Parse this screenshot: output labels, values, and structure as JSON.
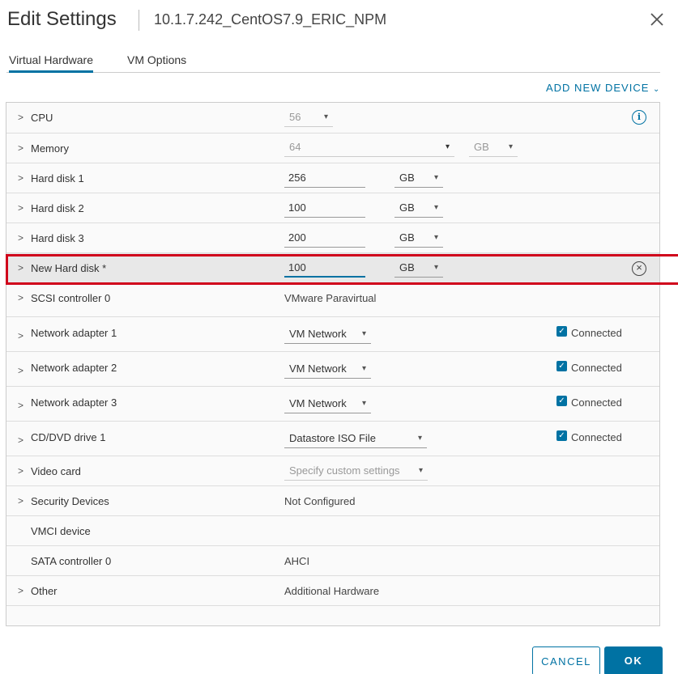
{
  "dialog": {
    "title": "Edit Settings",
    "subtitle": "10.1.7.242_CentOS7.9_ERIC_NPM"
  },
  "tabs": [
    {
      "label": "Virtual Hardware",
      "active": true
    },
    {
      "label": "VM Options",
      "active": false
    }
  ],
  "add_device_label": "ADD NEW DEVICE",
  "rows": {
    "cpu": {
      "label": "CPU",
      "value": "56"
    },
    "memory": {
      "label": "Memory",
      "value": "64",
      "unit": "GB"
    },
    "hd1": {
      "label": "Hard disk 1",
      "value": "256",
      "unit": "GB"
    },
    "hd2": {
      "label": "Hard disk 2",
      "value": "100",
      "unit": "GB"
    },
    "hd3": {
      "label": "Hard disk 3",
      "value": "200",
      "unit": "GB"
    },
    "newhd": {
      "label": "New Hard disk *",
      "value": "100",
      "unit": "GB"
    },
    "scsi": {
      "label": "SCSI controller 0",
      "value": "VMware Paravirtual"
    },
    "net1": {
      "label": "Network adapter 1",
      "value": "VM Network",
      "status": "Connected"
    },
    "net2": {
      "label": "Network adapter 2",
      "value": "VM Network",
      "status": "Connected"
    },
    "net3": {
      "label": "Network adapter 3",
      "value": "VM Network",
      "status": "Connected"
    },
    "cd": {
      "label": "CD/DVD drive 1",
      "value": "Datastore ISO File",
      "status": "Connected"
    },
    "video": {
      "label": "Video card",
      "value": "Specify custom settings"
    },
    "security": {
      "label": "Security Devices",
      "value": "Not Configured"
    },
    "vmci": {
      "label": "VMCI device"
    },
    "sata": {
      "label": "SATA controller 0",
      "value": "AHCI"
    },
    "other": {
      "label": "Other",
      "value": "Additional Hardware"
    }
  },
  "buttons": {
    "cancel": "CANCEL",
    "ok": "OK"
  },
  "colors": {
    "accent": "#0072a3",
    "highlight_border": "#d0021b"
  }
}
